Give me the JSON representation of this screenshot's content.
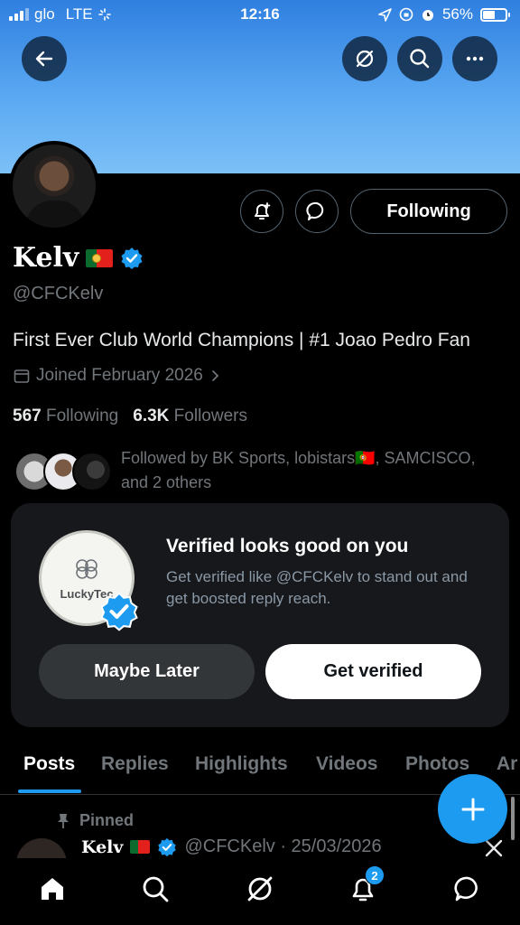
{
  "status_bar": {
    "carrier": "glo",
    "network": "LTE",
    "time": "12:16",
    "battery": "56%",
    "battery_level": 0.56
  },
  "header": {
    "back_icon": "arrow-left-icon",
    "grok_icon": "grok-icon",
    "search_icon": "search-icon",
    "more_icon": "more-icon"
  },
  "profile": {
    "name": "Kelv",
    "flag": "Portugal",
    "handle": "@CFCKelv",
    "bio": "First Ever Club World Champions | #1 Joao Pedro Fan",
    "joined": "Joined February 2026",
    "following_count": "567",
    "following_label": "Following",
    "followers_count": "6.3K",
    "followers_label": "Followers",
    "followed_by": "Followed by BK Sports, lobistars🇵🇹, SAMCISCO, and 2 others",
    "following_button": "Following"
  },
  "promo": {
    "logo_text": "LuckyTec",
    "title": "Verified looks good on you",
    "subtitle": "Get verified like @CFCKelv to stand out and get boosted reply reach.",
    "maybe_later": "Maybe Later",
    "get_verified": "Get verified"
  },
  "tabs": [
    "Posts",
    "Replies",
    "Highlights",
    "Videos",
    "Photos",
    "Ar"
  ],
  "active_tab": "Posts",
  "post": {
    "pinned_label": "Pinned",
    "author": "Kelv",
    "handle_date": "@CFCKelv · 25/03/2026"
  },
  "bottom_nav": {
    "notification_count": "2"
  },
  "colors": {
    "accent": "#1d9bf0",
    "background": "#000000",
    "muted_text": "#71767b"
  }
}
